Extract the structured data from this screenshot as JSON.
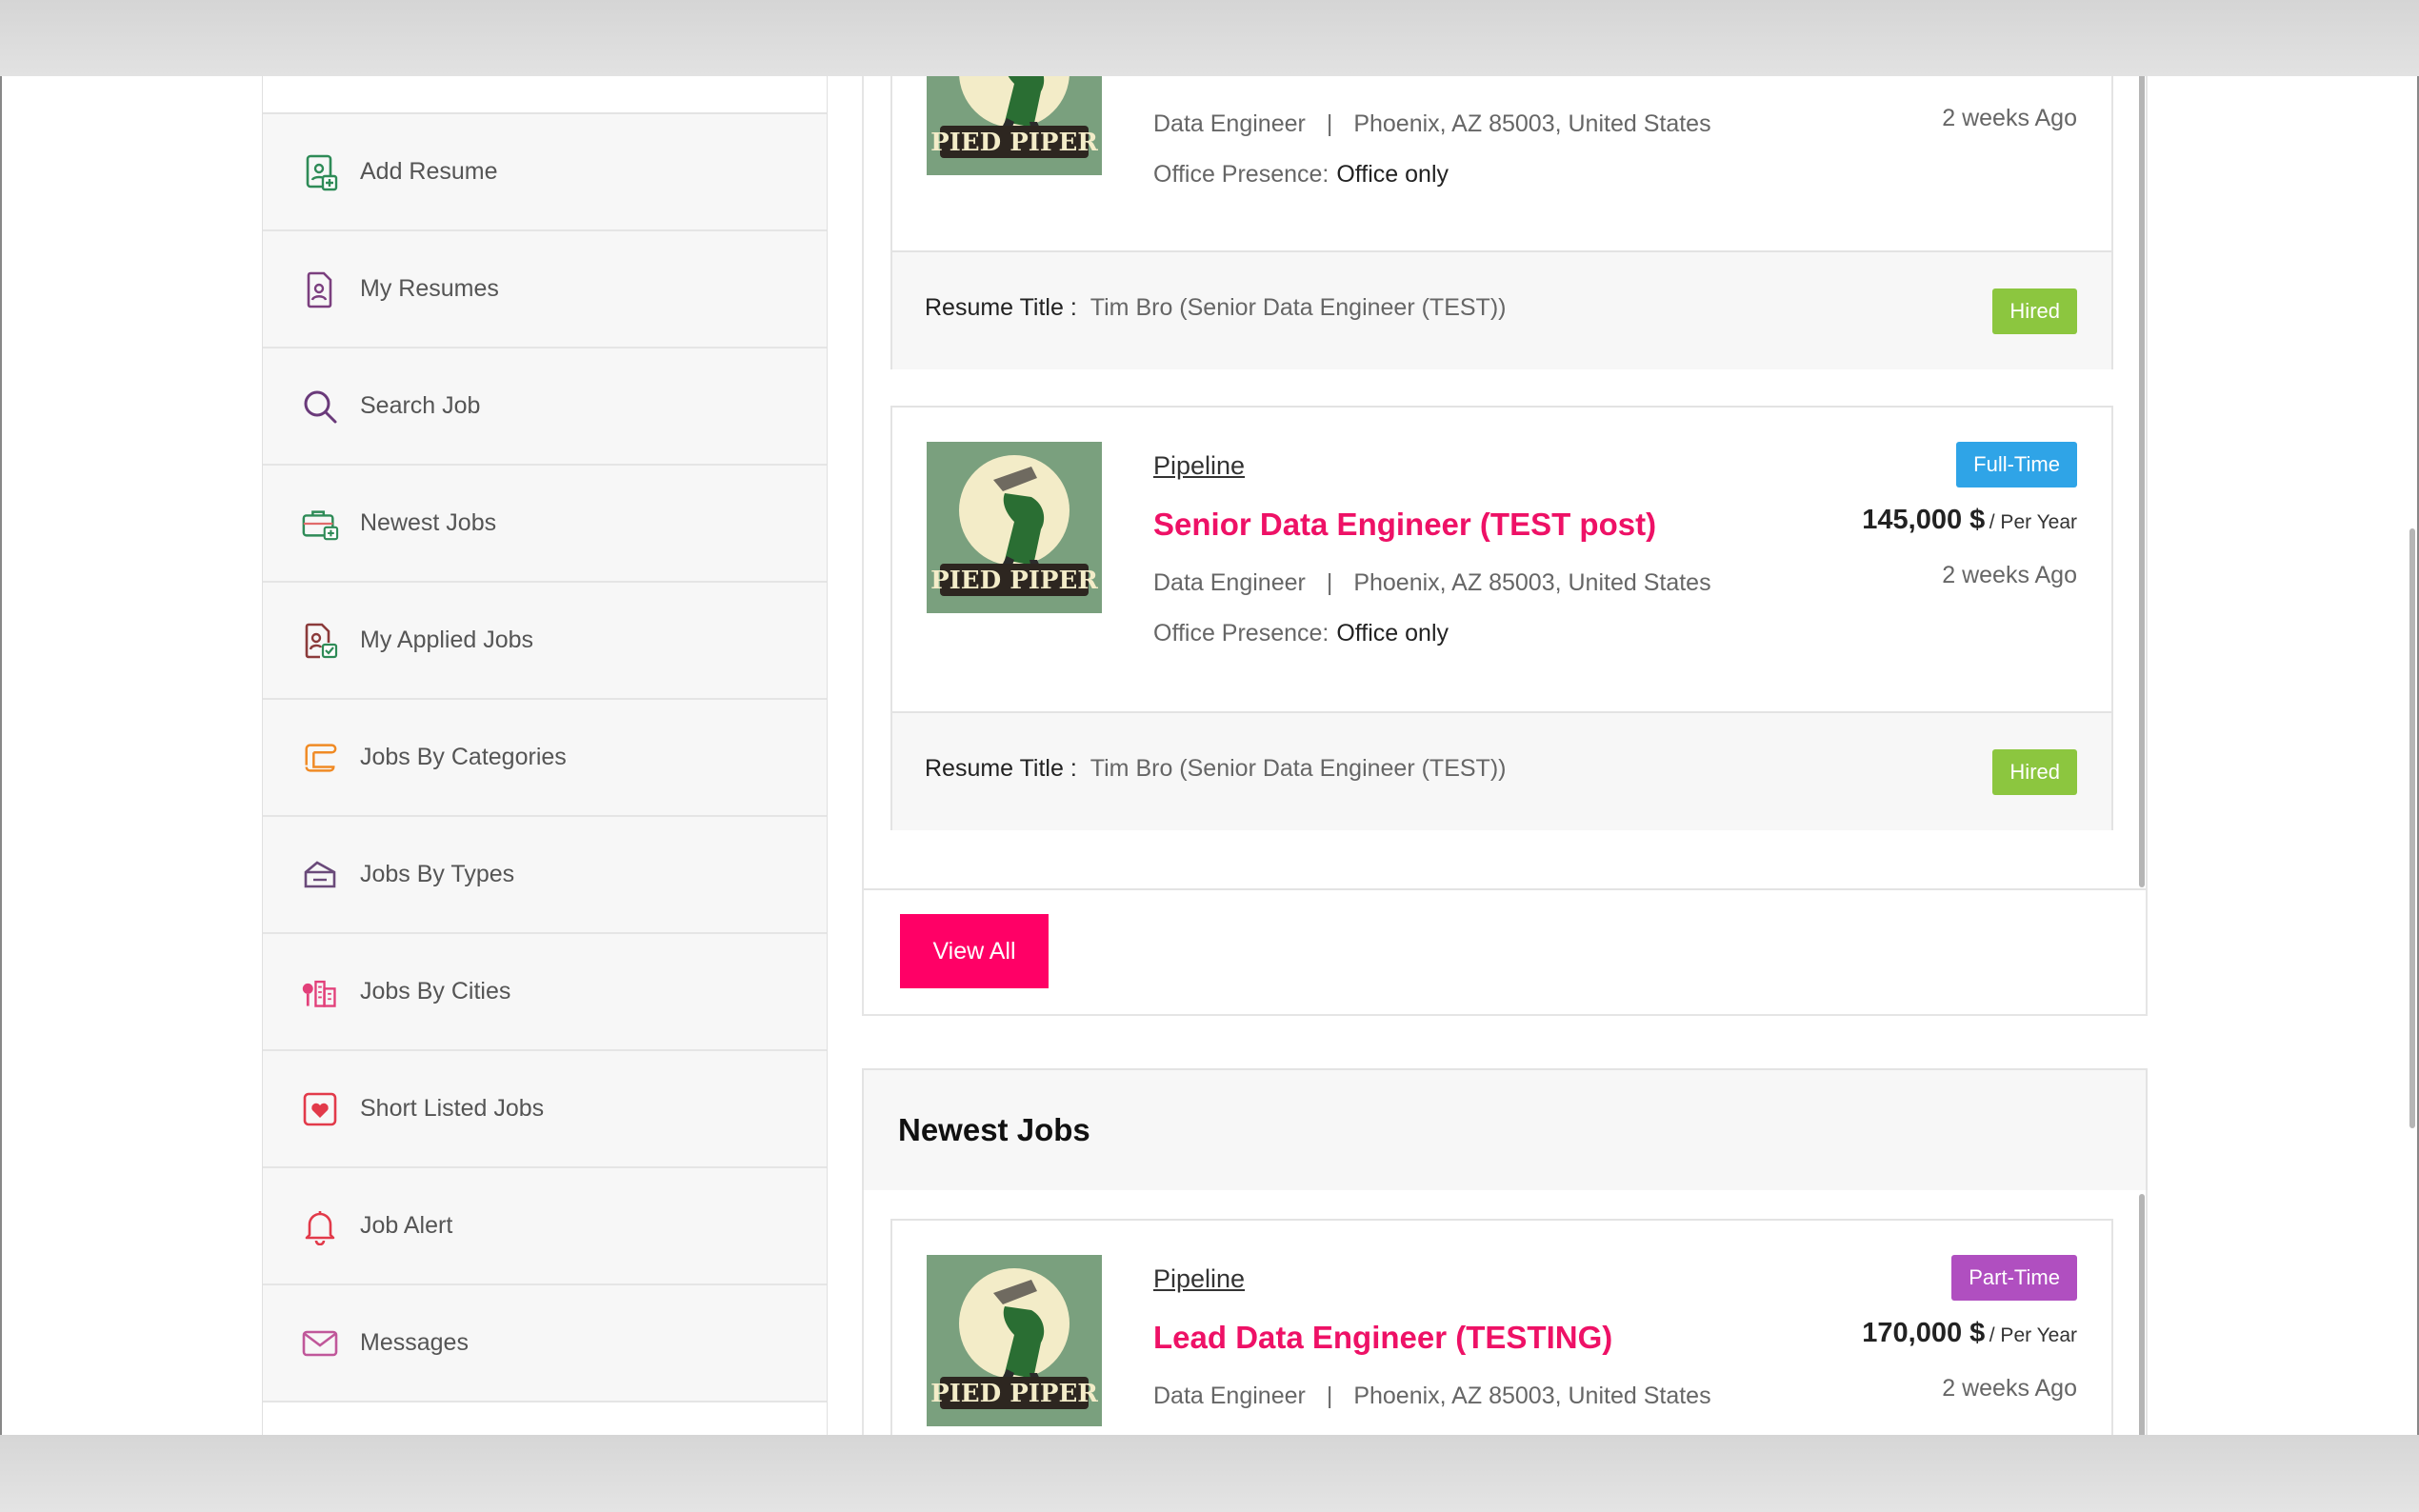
{
  "sidebar": {
    "items": [
      {
        "label": "Add Resume",
        "icon": "add-resume-icon"
      },
      {
        "label": "My Resumes",
        "icon": "resume-icon"
      },
      {
        "label": "Search Job",
        "icon": "search-icon"
      },
      {
        "label": "Newest Jobs",
        "icon": "briefcase-icon"
      },
      {
        "label": "My Applied Jobs",
        "icon": "applied-jobs-icon"
      },
      {
        "label": "Jobs By Categories",
        "icon": "scroll-icon"
      },
      {
        "label": "Jobs By Types",
        "icon": "types-icon"
      },
      {
        "label": "Jobs By Cities",
        "icon": "city-icon"
      },
      {
        "label": "Short Listed Jobs",
        "icon": "heart-icon"
      },
      {
        "label": "Job Alert",
        "icon": "bell-icon"
      },
      {
        "label": "Messages",
        "icon": "envelope-icon"
      }
    ]
  },
  "applied": {
    "cards": [
      {
        "category": "Data Engineer",
        "location": "Phoenix, AZ 85003, United States",
        "separator": "|",
        "presence_label": "Office Presence:",
        "presence_value": "Office only",
        "posted": "2 weeks Ago",
        "resume_label": "Resume Title :",
        "resume_value": "Tim Bro (Senior Data Engineer (TEST))",
        "status": "Hired"
      },
      {
        "company": "Pipeline",
        "title": "Senior Data Engineer (TEST post)",
        "type": "Full-Time",
        "salary": "145,000 $",
        "period": "/ Per Year",
        "category": "Data Engineer",
        "separator": "|",
        "location": "Phoenix, AZ 85003, United States",
        "presence_label": "Office Presence:",
        "presence_value": "Office only",
        "posted": "2 weeks Ago",
        "resume_label": "Resume Title :",
        "resume_value": "Tim Bro (Senior Data Engineer (TEST))",
        "status": "Hired"
      }
    ],
    "view_all": "View All"
  },
  "newest": {
    "heading": "Newest Jobs",
    "cards": [
      {
        "company": "Pipeline",
        "title": "Lead Data Engineer (TESTING)",
        "type": "Part-Time",
        "salary": "170,000 $",
        "period": "/ Per Year",
        "category": "Data Engineer",
        "separator": "|",
        "location": "Phoenix, AZ 85003, United States",
        "posted": "2 weeks Ago"
      }
    ]
  },
  "logo": {
    "text": "PIED PIPER"
  },
  "colors": {
    "accent": "#ff0066",
    "title": "#ee1166",
    "hired": "#8cc63f",
    "full_time": "#2fa4e7",
    "part_time": "#b04fc0"
  }
}
